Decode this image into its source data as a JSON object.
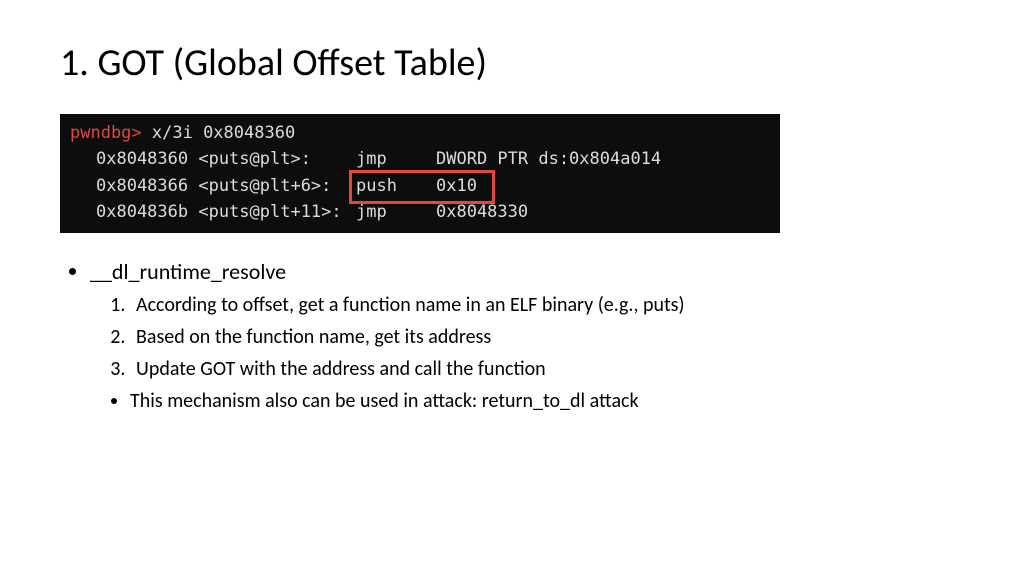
{
  "title": "1. GOT (Global Offset Table)",
  "terminal": {
    "prompt": "pwndbg>",
    "command": " x/3i 0x8048360",
    "lines": [
      {
        "addr": "0x8048360 <puts@plt>:",
        "mnem": "jmp",
        "ops": "DWORD PTR ds:0x804a014"
      },
      {
        "addr": "0x8048366 <puts@plt+6>:",
        "mnem": "push",
        "ops": "0x10"
      },
      {
        "addr": "0x804836b <puts@plt+11>:",
        "mnem": "jmp",
        "ops": "0x8048330"
      }
    ]
  },
  "bullets": {
    "main": "__dl_runtime_resolve",
    "steps": [
      "According to offset, get a function name in an ELF binary (e.g., puts)",
      "Based on the function name, get its address",
      "Update GOT with the address and call the function"
    ],
    "note": "This mechanism also can be used in attack: return_to_dl attack"
  }
}
